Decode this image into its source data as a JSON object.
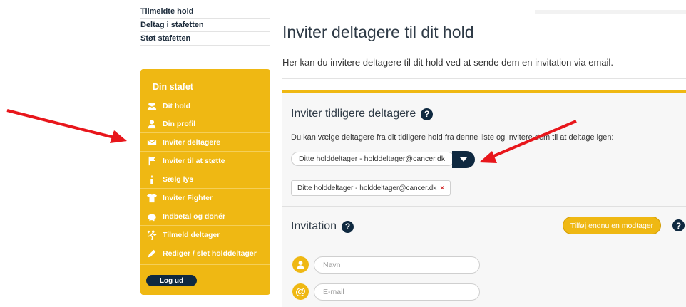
{
  "top_links": [
    "Tilmeldte hold",
    "Deltag i stafetten",
    "Støt stafetten"
  ],
  "sidebar": {
    "title": "Din stafet",
    "items": [
      {
        "label": "Dit hold",
        "icon": "group-icon"
      },
      {
        "label": "Din profil",
        "icon": "person-icon"
      },
      {
        "label": "Inviter deltagere",
        "icon": "envelope-icon"
      },
      {
        "label": "Inviter til at støtte",
        "icon": "flag-icon"
      },
      {
        "label": "Sælg lys",
        "icon": "candle-icon"
      },
      {
        "label": "Inviter Fighter",
        "icon": "tshirt-icon"
      },
      {
        "label": "Indbetal og donér",
        "icon": "piggy-bank-icon"
      },
      {
        "label": "Tilmeld deltager",
        "icon": "runner-plus-icon"
      },
      {
        "label": "Rediger / slet holddeltager",
        "icon": "pencil-icon"
      }
    ],
    "logout": "Log ud"
  },
  "main": {
    "title": "Inviter deltagere til dit hold",
    "intro": "Her kan du invitere deltagere til dit hold ved at sende dem en invitation via email.",
    "previous": {
      "title": "Inviter tidligere deltagere",
      "help": "?",
      "description": "Du kan vælge deltagere fra dit tidligere hold fra denne liste og invitere dem til at deltage igen:",
      "selected_option": "Ditte holddeltager - holddeltager@cancer.dk",
      "tag_label": "Ditte holddeltager - holddeltager@cancer.dk",
      "tag_remove": "×"
    },
    "invitation": {
      "title": "Invitation",
      "help": "?",
      "add_button": "Tilføj endnu en modtager",
      "name_placeholder": "Navn",
      "email_placeholder": "E-mail",
      "email_icon_glyph": "@"
    }
  },
  "colors": {
    "accent": "#efb813",
    "navy": "#0f2940",
    "annotation": "#e8161b"
  }
}
